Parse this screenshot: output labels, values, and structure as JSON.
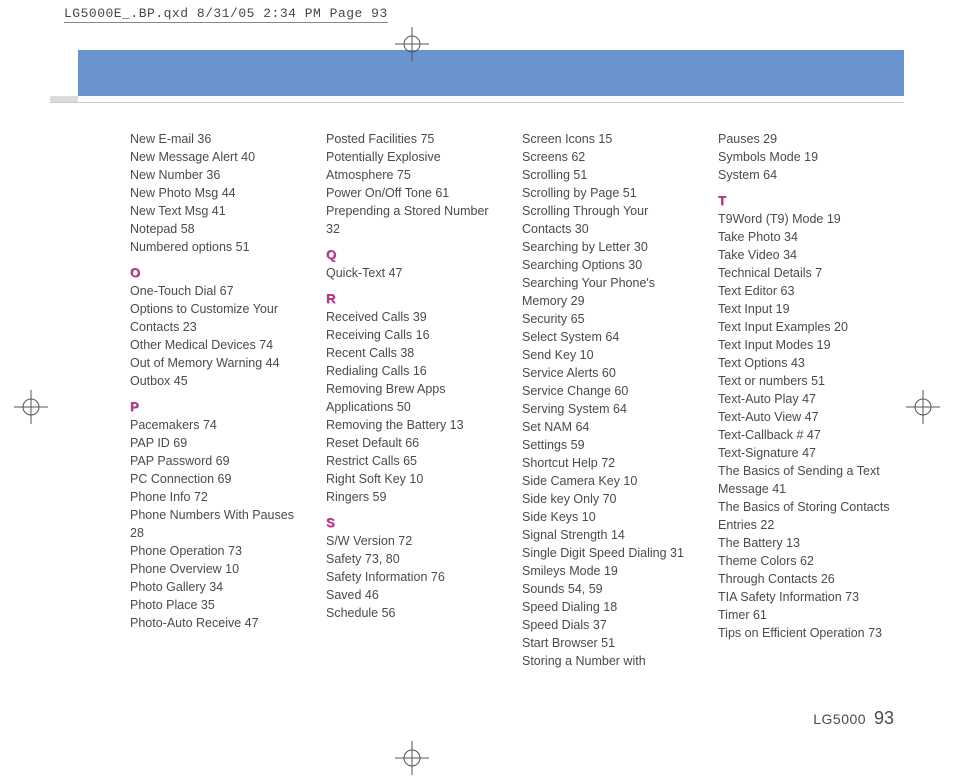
{
  "print_header": "LG5000E_.BP.qxd  8/31/05  2:34 PM  Page 93",
  "footer_model": "LG5000",
  "footer_page": "93",
  "columns": [
    {
      "groups": [
        {
          "letter": "",
          "entries": [
            "New E-mail 36",
            "New Message Alert 40",
            "New Number 36",
            "New Photo Msg 44",
            "New Text Msg 41",
            "Notepad 58",
            "Numbered options 51"
          ]
        },
        {
          "letter": "O",
          "entries": [
            "One-Touch Dial 67",
            "Options to Customize Your Contacts 23",
            "Other Medical Devices 74",
            "Out of Memory Warning 44",
            "Outbox 45"
          ]
        },
        {
          "letter": "P",
          "entries": [
            "Pacemakers 74",
            "PAP ID 69",
            "PAP Password 69",
            "PC Connection 69",
            "Phone Info 72",
            "Phone Numbers With Pauses 28",
            "Phone Operation 73",
            "Phone Overview 10",
            "Photo Gallery 34",
            "Photo Place 35",
            "Photo-Auto Receive 47"
          ]
        }
      ]
    },
    {
      "groups": [
        {
          "letter": "",
          "entries": [
            "Posted Facilities 75",
            "Potentially Explosive Atmosphere 75",
            "Power On/Off Tone 61",
            "Prepending a Stored Number 32"
          ]
        },
        {
          "letter": "Q",
          "entries": [
            "Quick-Text 47"
          ]
        },
        {
          "letter": "R",
          "entries": [
            "Received Calls 39",
            "Receiving Calls 16",
            "Recent Calls 38",
            "Redialing Calls 16",
            "Removing Brew Apps Applications 50",
            "Removing the Battery 13",
            "Reset Default 66",
            "Restrict Calls 65",
            "Right Soft Key 10",
            "Ringers 59"
          ]
        },
        {
          "letter": "S",
          "entries": [
            "S/W Version 72",
            "Safety 73, 80",
            "Safety Information 76",
            "Saved 46",
            "Schedule 56"
          ]
        }
      ]
    },
    {
      "groups": [
        {
          "letter": "",
          "entries": [
            "Screen Icons 15",
            "Screens 62",
            "Scrolling 51",
            "Scrolling by Page 51",
            "Scrolling Through Your Contacts 30",
            "Searching by Letter 30",
            "Searching Options 30",
            "Searching Your Phone's Memory 29",
            "Security 65",
            "Select System 64",
            "Send Key 10",
            "Service Alerts 60",
            "Service Change 60",
            "Serving System 64",
            "Set NAM 64",
            "Settings 59",
            "Shortcut Help 72",
            "Side Camera Key 10",
            "Side key Only 70",
            "Side Keys 10",
            "Signal Strength 14",
            "Single Digit Speed Dialing 31",
            "Smileys Mode 19",
            "Sounds 54, 59",
            "Speed Dialing 18",
            "Speed Dials 37",
            "Start Browser 51",
            "Storing a Number with"
          ]
        }
      ]
    },
    {
      "groups": [
        {
          "letter": "",
          "entries": [
            "Pauses 29",
            "Symbols Mode 19",
            "System 64"
          ]
        },
        {
          "letter": "T",
          "entries": [
            "T9Word (T9) Mode 19",
            "Take Photo 34",
            "Take Video 34",
            "Technical Details 7",
            "Text Editor 63",
            "Text Input 19",
            "Text Input Examples 20",
            "Text Input Modes 19",
            "Text Options 43",
            "Text or numbers 51",
            "Text-Auto Play 47",
            "Text-Auto View 47",
            "Text-Callback # 47",
            "Text-Signature 47",
            "The Basics of Sending a Text Message 41",
            "The Basics of Storing Contacts Entries 22",
            "The Battery 13",
            "Theme Colors 62",
            "Through Contacts 26",
            "TIA Safety Information 73",
            "Timer 61",
            "Tips on Efficient Operation 73"
          ]
        }
      ]
    }
  ]
}
